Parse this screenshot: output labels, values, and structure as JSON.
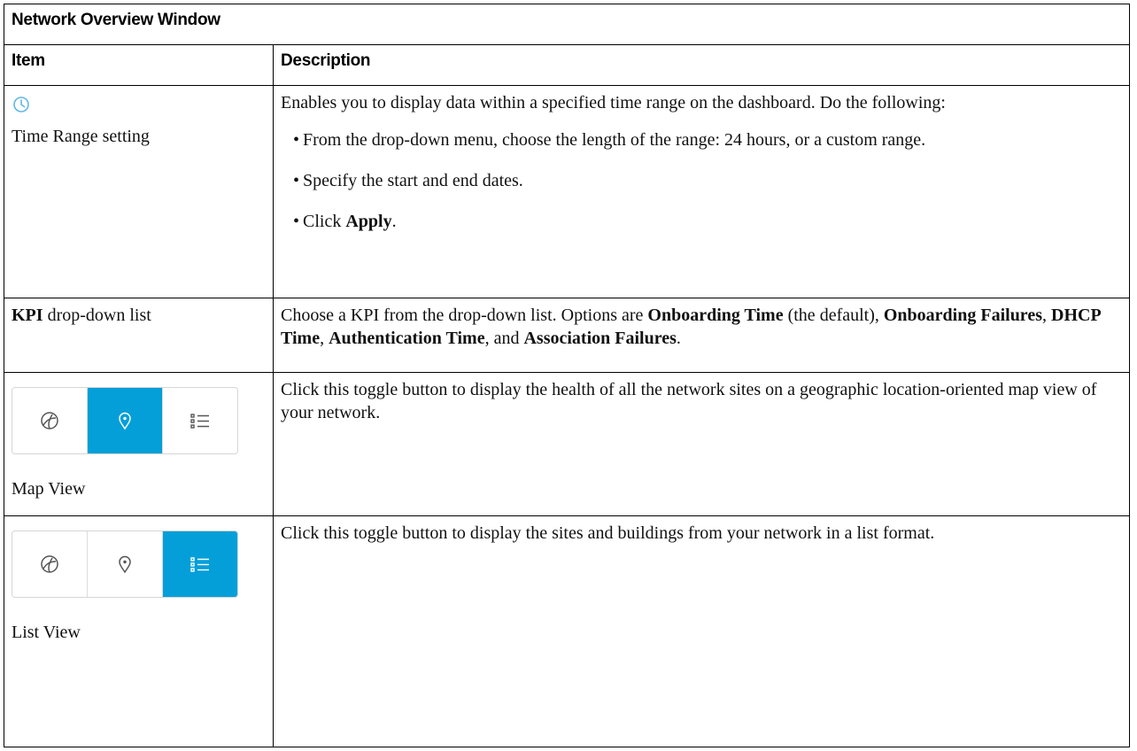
{
  "table_title": "Network Overview Window",
  "columns": {
    "item": "Item",
    "description": "Description"
  },
  "rows": {
    "time_range": {
      "item_label": "Time Range setting",
      "icon": "clock-icon",
      "intro": "Enables you to display data within a specified time range on the dashboard. Do the following:",
      "steps": [
        "From the drop-down menu, choose the length of the range: 24 hours, or a custom range.",
        "Specify the start and end dates."
      ],
      "step3_prefix": "Click ",
      "step3_bold": "Apply",
      "step3_suffix": "."
    },
    "kpi": {
      "item_bold": "KPI",
      "item_rest": " drop-down list",
      "desc_prefix": "Choose a KPI from the drop-down list. Options are ",
      "opt1": "Onboarding Time",
      "opt1_note": " (the default),",
      "opt2": "Onboarding Failures",
      "sep_comma": ", ",
      "opt3": "DHCP Time",
      "sep_comma2": ", ",
      "opt4": "Authentication Time",
      "sep_and": ", and ",
      "opt5": "Association Failures",
      "end": "."
    },
    "map_view": {
      "item_label": "Map View",
      "description": "Click this toggle button to display the health of all the network sites on a geographic location-oriented map view of your network.",
      "toggle_icons": [
        "globe-icon",
        "map-pin-icon",
        "list-icon"
      ],
      "active": "map-pin-icon"
    },
    "list_view": {
      "item_label": "List View",
      "description": "Click this toggle button to display the sites and buildings from your network in a list format.",
      "toggle_icons": [
        "globe-icon",
        "map-pin-icon",
        "list-icon"
      ],
      "active": "list-icon"
    }
  },
  "colors": {
    "accent": "#049fd9",
    "icon_gray": "#555555",
    "clock": "#5fb7e5"
  }
}
